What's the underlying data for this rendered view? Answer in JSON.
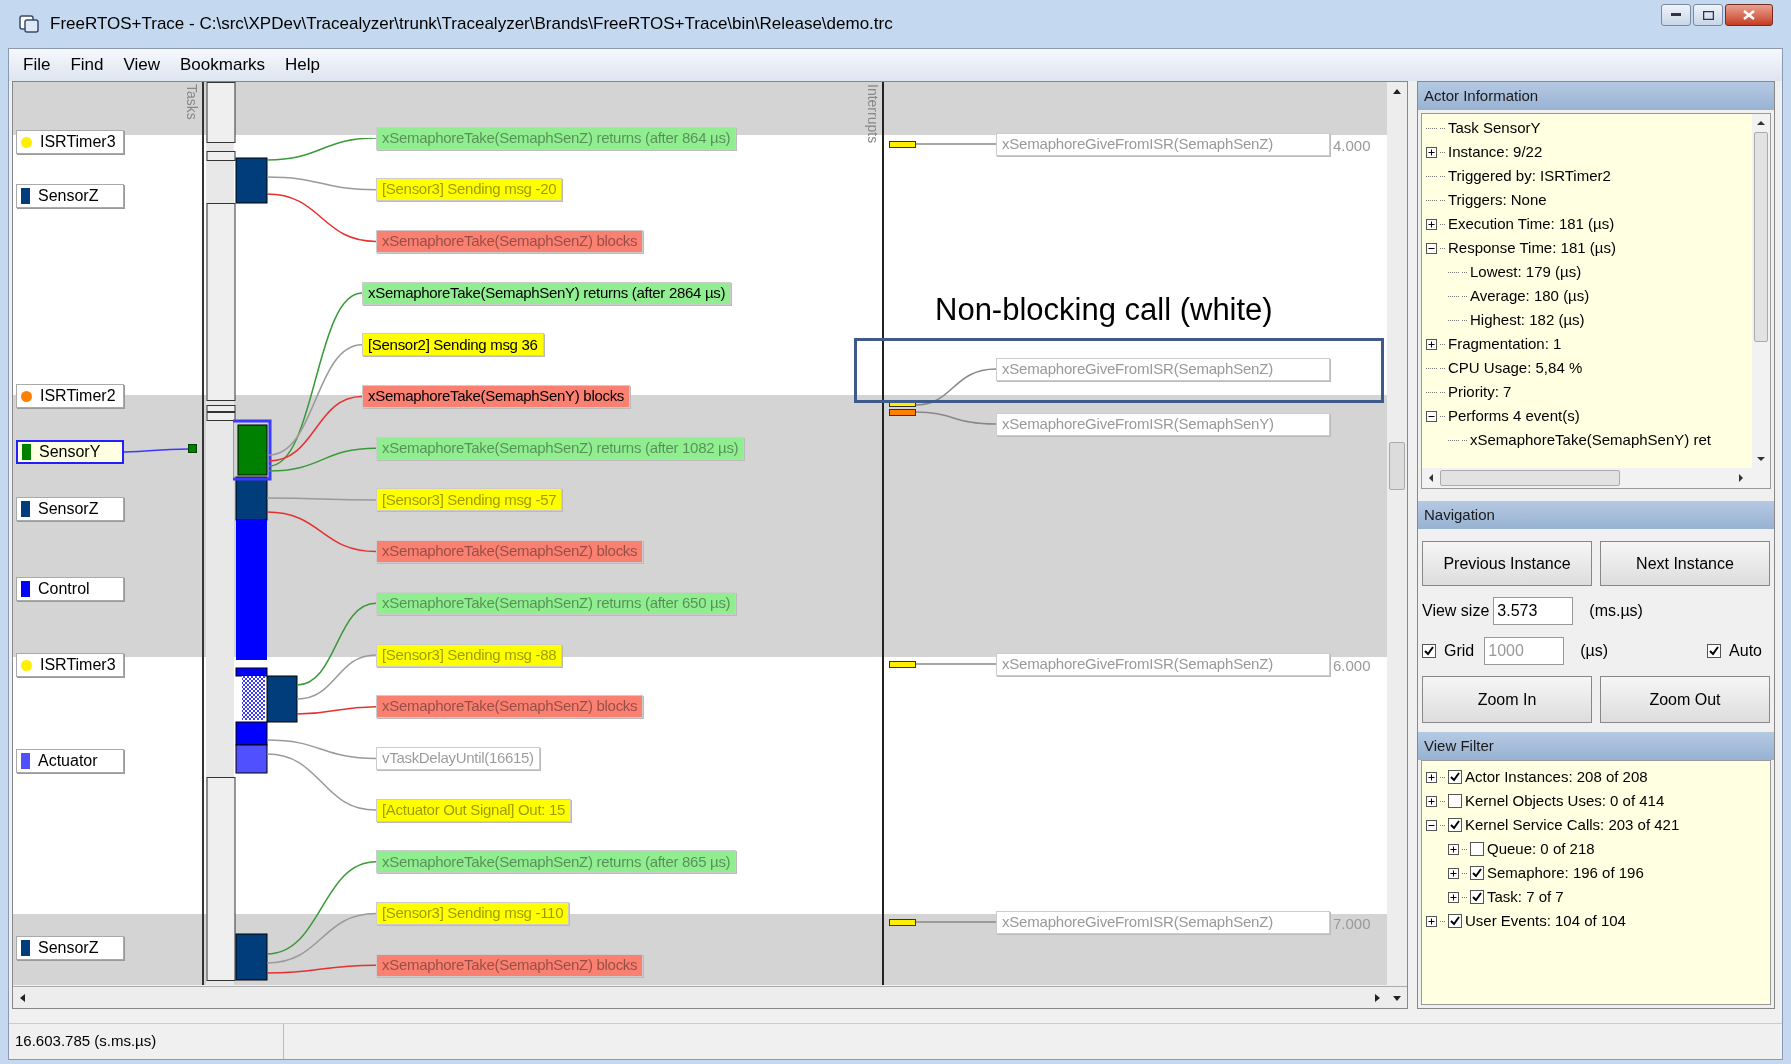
{
  "window": {
    "title": "FreeRTOS+Trace  - C:\\src\\XPDev\\Tracealyzer\\trunk\\Tracealyzer\\Brands\\FreeRTOS+Trace\\bin\\Release\\demo.trc"
  },
  "menu": [
    "File",
    "Find",
    "View",
    "Bookmarks",
    "Help"
  ],
  "trace": {
    "tasks_label": "Tasks",
    "interrupts_label": "Interrupts",
    "actors": [
      {
        "name": "ISRTimer3",
        "kind": "isr",
        "color": "#ffee00",
        "selected": false
      },
      {
        "name": "SensorZ",
        "kind": "task",
        "color": "#003d7a",
        "selected": false
      },
      {
        "name": "ISRTimer2",
        "kind": "isr",
        "color": "#ff7f00",
        "selected": false
      },
      {
        "name": "SensorY",
        "kind": "task",
        "color": "#008000",
        "selected": true
      },
      {
        "name": "SensorZ",
        "kind": "task",
        "color": "#003d7a",
        "selected": false
      },
      {
        "name": "Control",
        "kind": "task",
        "color": "#0000ff",
        "selected": false
      },
      {
        "name": "ISRTimer3",
        "kind": "isr",
        "color": "#ffee00",
        "selected": false
      },
      {
        "name": "Actuator",
        "kind": "task",
        "color": "#5050ff",
        "selected": false
      },
      {
        "name": "SensorZ",
        "kind": "task",
        "color": "#003d7a",
        "selected": false
      }
    ],
    "events": [
      {
        "text": "xSemaphoreTake(SemaphSenZ) returns (after 864 µs)",
        "kind": "returns",
        "dimmed": true
      },
      {
        "text": "[Sensor3] Sending msg -20",
        "kind": "message",
        "dimmed": true
      },
      {
        "text": "xSemaphoreTake(SemaphSenZ) blocks",
        "kind": "blocks",
        "dimmed": true
      },
      {
        "text": "xSemaphoreTake(SemaphSenY) returns (after 2864 µs)",
        "kind": "returns",
        "dimmed": false
      },
      {
        "text": "[Sensor2] Sending msg 36",
        "kind": "message",
        "dimmed": false
      },
      {
        "text": "xSemaphoreTake(SemaphSenY) blocks",
        "kind": "blocks",
        "dimmed": false
      },
      {
        "text": "xSemaphoreTake(SemaphSenZ) returns (after 1082 µs)",
        "kind": "returns",
        "dimmed": true
      },
      {
        "text": "[Sensor3] Sending msg -57",
        "kind": "message",
        "dimmed": true
      },
      {
        "text": "xSemaphoreTake(SemaphSenZ) blocks",
        "kind": "blocks",
        "dimmed": true
      },
      {
        "text": "xSemaphoreTake(SemaphSenZ) returns (after 650 µs)",
        "kind": "returns",
        "dimmed": true
      },
      {
        "text": "[Sensor3] Sending msg -88",
        "kind": "message",
        "dimmed": true
      },
      {
        "text": "xSemaphoreTake(SemaphSenZ) blocks",
        "kind": "blocks",
        "dimmed": true
      },
      {
        "text": "vTaskDelayUntil(16615)",
        "kind": "call",
        "dimmed": true
      },
      {
        "text": "[Actuator Out Signal] Out: 15",
        "kind": "message",
        "dimmed": true
      },
      {
        "text": "xSemaphoreTake(SemaphSenZ) returns (after 865 µs)",
        "kind": "returns",
        "dimmed": true
      },
      {
        "text": "[Sensor3] Sending msg -110",
        "kind": "message",
        "dimmed": true
      },
      {
        "text": "xSemaphoreTake(SemaphSenZ) blocks",
        "kind": "blocks",
        "dimmed": true
      }
    ],
    "interrupt_events": [
      {
        "text": "xSemaphoreGiveFromISR(SemaphSenZ)",
        "color": "#ffee00"
      },
      {
        "text": "xSemaphoreGiveFromISR(SemaphSenZ)",
        "color": "#ffee00"
      },
      {
        "text": "xSemaphoreGiveFromISR(SemaphSenY)",
        "color": "#ff7f00"
      },
      {
        "text": "xSemaphoreGiveFromISR(SemaphSenZ)",
        "color": "#ffee00"
      },
      {
        "text": "xSemaphoreGiveFromISR(SemaphSenZ)",
        "color": "#ffee00"
      }
    ],
    "time_labels": [
      "4.000",
      "6.000",
      "7.000"
    ],
    "annotation": "Non-blocking call (white)"
  },
  "actor_information": {
    "title": "Actor Information",
    "items": [
      {
        "label": "Task SensorY"
      },
      {
        "label": "Instance: 9/22",
        "expanded": false
      },
      {
        "label": "Triggered by: ISRTimer2"
      },
      {
        "label": "Triggers: None"
      },
      {
        "label": "Execution Time: 181 (µs)",
        "expanded": false
      },
      {
        "label": "Response Time: 181 (µs)",
        "expanded": true,
        "children": [
          {
            "label": "Lowest: 179 (µs)"
          },
          {
            "label": "Average: 180 (µs)"
          },
          {
            "label": "Highest: 182 (µs)"
          }
        ]
      },
      {
        "label": "Fragmentation: 1",
        "expanded": false
      },
      {
        "label": "CPU Usage: 5,84 %"
      },
      {
        "label": "Priority: 7"
      },
      {
        "label": "Performs 4 event(s)",
        "expanded": true,
        "children": [
          {
            "label": "xSemaphoreTake(SemaphSenY) ret"
          }
        ]
      }
    ]
  },
  "navigation": {
    "title": "Navigation",
    "instance_buttons": [
      "Previous Instance",
      "Next Instance"
    ],
    "view_size": {
      "label": "View size",
      "value": "3.573",
      "unit": "(ms.µs)"
    },
    "grid": {
      "label": "Grid",
      "checked": true,
      "value": "1000",
      "disabled": true,
      "unit": "(µs)"
    },
    "auto": {
      "label": "Auto",
      "checked": true
    },
    "zoom_buttons": [
      "Zoom In",
      "Zoom Out"
    ]
  },
  "view_filter": {
    "title": "View Filter",
    "items": [
      {
        "label": "Actor Instances: 208 of 208",
        "expanded": false,
        "checked": true
      },
      {
        "label": "Kernel Objects Uses: 0 of 414",
        "expanded": false,
        "checked": false
      },
      {
        "label": "Kernel Service Calls: 203 of 421",
        "expanded": true,
        "checked": true,
        "children": [
          {
            "label": "Queue: 0 of 218",
            "expanded": false,
            "checked": false
          },
          {
            "label": "Semaphore: 196 of 196",
            "expanded": false,
            "checked": true
          },
          {
            "label": "Task: 7 of 7",
            "expanded": false,
            "checked": true
          }
        ]
      },
      {
        "label": "User Events: 104 of 104",
        "expanded": false,
        "checked": true
      }
    ]
  },
  "status_bar": {
    "time": "16.603.785 (s.ms.µs)"
  }
}
